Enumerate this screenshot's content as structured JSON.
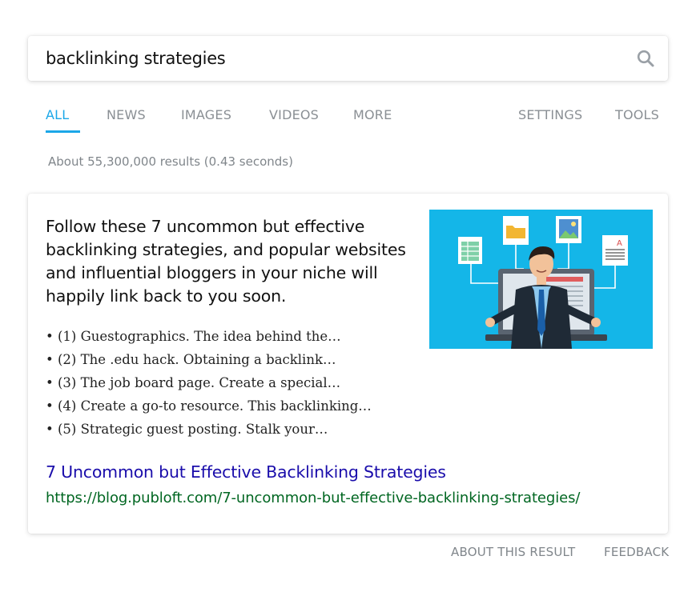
{
  "search": {
    "query": "backlinking strategies",
    "icon": "search-icon"
  },
  "tabs": [
    {
      "label": "ALL",
      "active": true
    },
    {
      "label": "NEWS",
      "active": false
    },
    {
      "label": "IMAGES",
      "active": false
    },
    {
      "label": "VIDEOS",
      "active": false
    },
    {
      "label": "MORE",
      "active": false
    },
    {
      "label": "SETTINGS",
      "active": false
    },
    {
      "label": "TOOLS",
      "active": false
    }
  ],
  "result_stats": "About 55,300,000 results (0.43 seconds)",
  "featured_snippet": {
    "heading": "Follow these 7 uncommon but effective backlinking strategies, and popular websites and influential bloggers in your niche will happily link back to you soon.",
    "items": [
      "• (1) Guestographics. The idea behind the…",
      "• (2) The .edu hack. Obtaining a backlink…",
      "• (3) The job board page. Create a special…",
      "• (4) Create a go-to resource. This backlinking…",
      "• (5) Strategic guest posting. Stalk your…"
    ],
    "thumbnail": "businessman-with-documents-illustration",
    "title": "7 Uncommon but Effective Backlinking Strategies",
    "url": "https://blog.publoft.com/7-uncommon-but-effective-backlinking-strategies/"
  },
  "footer": {
    "about": "ABOUT THIS RESULT",
    "feedback": "FEEDBACK"
  },
  "colors": {
    "accent": "#1ba7e8",
    "link": "#1a0dab",
    "url": "#006621",
    "muted": "#80868b",
    "thumbnail_bg": "#14b6e8"
  }
}
